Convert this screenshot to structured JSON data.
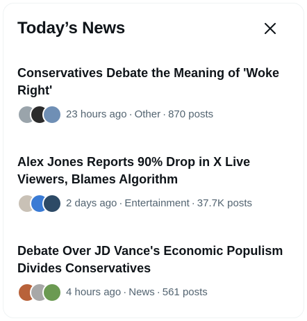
{
  "header": {
    "title": "Today’s News"
  },
  "close": {
    "label": "Close"
  },
  "stories": [
    {
      "title": "Conservatives Debate the Meaning of 'Woke Right'",
      "time": "23 hours ago",
      "category": "Other",
      "posts": "870 posts",
      "avatar_colors": [
        "#9aa4ab",
        "#2b2b2b",
        "#6f8fb5"
      ]
    },
    {
      "title": "Alex Jones Reports 90% Drop in X Live Viewers, Blames Algorithm",
      "time": "2 days ago",
      "category": "Entertainment",
      "posts": "37.7K posts",
      "avatar_colors": [
        "#c9c1b6",
        "#3a7bd5",
        "#2d4a66"
      ]
    },
    {
      "title": "Debate Over JD Vance's Economic Populism Divides Conservatives",
      "time": "4 hours ago",
      "category": "News",
      "posts": "561 posts",
      "avatar_colors": [
        "#b8623a",
        "#a8a8a8",
        "#6b9a52"
      ]
    }
  ]
}
